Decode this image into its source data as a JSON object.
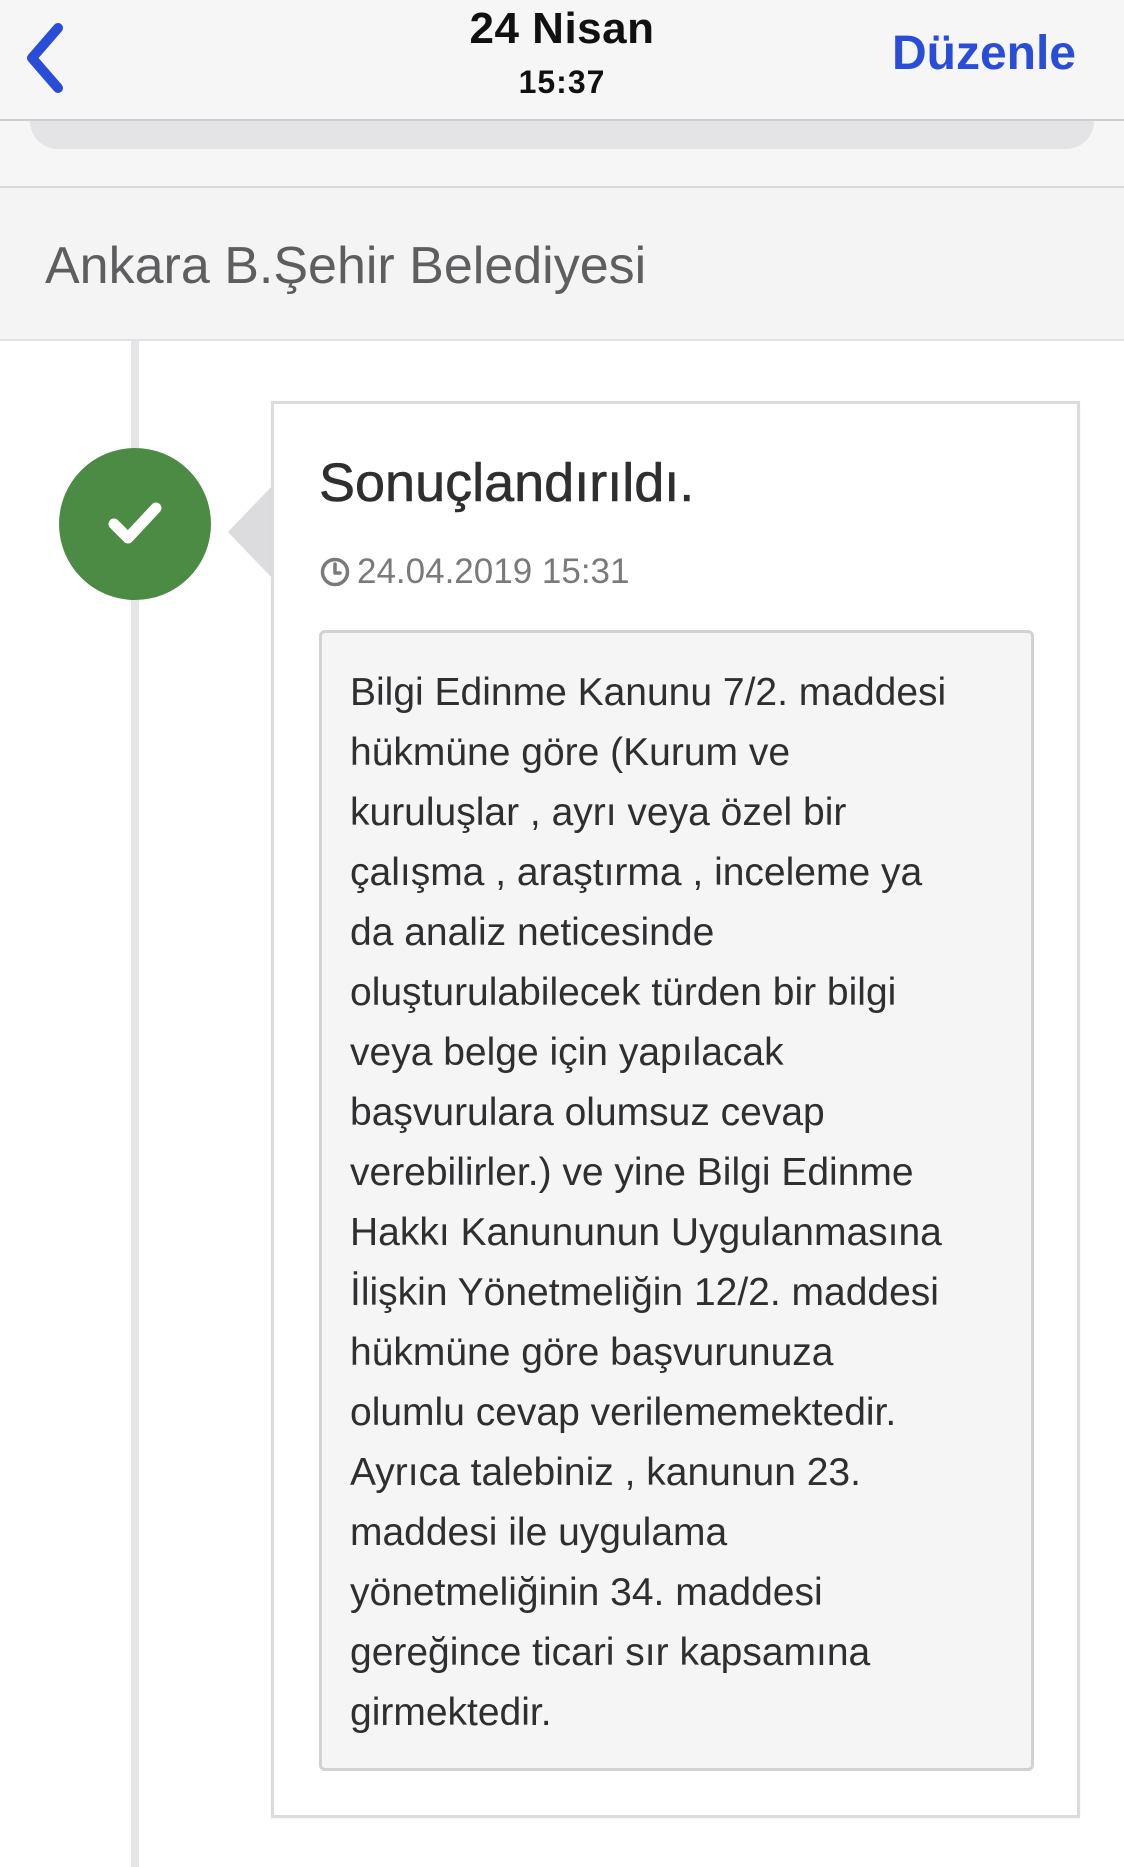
{
  "navbar": {
    "title": "24 Nisan",
    "subtitle": "15:37",
    "back_icon": "chevron-left-icon",
    "edit_label": "Düzenle",
    "accent_color": "#2a4dd8"
  },
  "section": {
    "title": "Ankara B.Şehir Belediyesi"
  },
  "timeline": {
    "status_icon": "checkmark-icon",
    "status_color": "#4c8b44"
  },
  "card": {
    "status_title": "Sonuçlandırıldı.",
    "date_icon": "clock-icon",
    "date": "24.04.2019 15:31",
    "body": "Bilgi Edinme Kanunu 7/2. maddesi\nhükmüne göre (Kurum ve\nkuruluşlar , ayrı veya özel bir\nçalışma , araştırma ,  inceleme ya\nda analiz neticesinde\noluşturulabilecek türden bir bilgi\nveya belge için yapılacak\nbaşvurulara olumsuz cevap\nverebilirler.) ve yine Bilgi Edinme\nHakkı Kanununun Uygulanmasına\nİlişkin Yönetmeliğin 12/2. maddesi\nhükmüne göre başvurunuza\nolumlu cevap verilememektedir.\nAyrıca talebiniz , kanunun 23.\nmaddesi ile uygulama\nyönetmeliğinin 34. maddesi\ngereğince ticari sır kapsamına\ngirmektedir."
  }
}
